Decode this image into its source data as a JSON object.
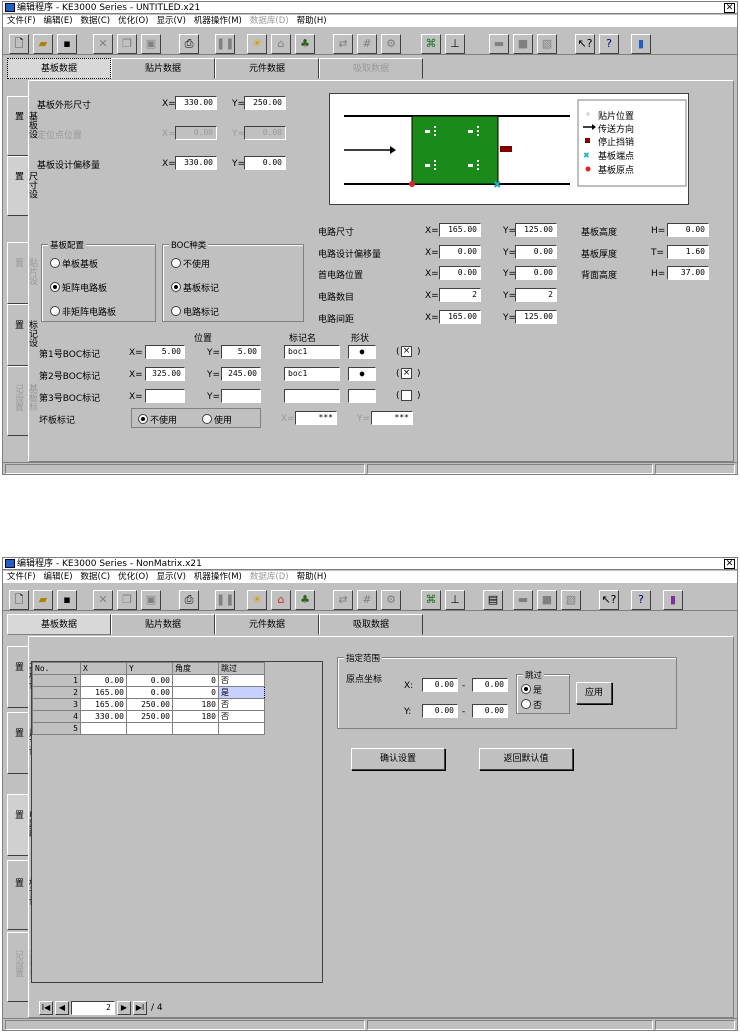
{
  "w1": {
    "title": "编辑程序 - KE3000 Series - UNTITLED.x21",
    "close": "✕",
    "menu": [
      "文件(F)",
      "编辑(E)",
      "数据(C)",
      "优化(O)",
      "显示(V)",
      "机器操作(M)",
      "数据库(D)",
      "帮助(H)"
    ],
    "tabs": [
      "基板数据",
      "贴片数据",
      "元件数据",
      "吸取数据"
    ],
    "side": [
      "基板设置",
      "尺寸设置",
      "贴片设置",
      "标记设置",
      "基板标记设置"
    ],
    "rows": [
      {
        "label": "基板外形尺寸",
        "x": "330.00",
        "y": "250.00"
      },
      {
        "label": "定位点位置",
        "x": "0.00",
        "y": "0.00"
      },
      {
        "label": "基板设计偏移量",
        "x": "330.00",
        "y": "0.00"
      }
    ],
    "xp": "X=",
    "yp": "Y=",
    "legend": [
      "贴片位置",
      "传送方向",
      "停止挡销",
      "基板端点",
      "基板原点"
    ],
    "right_rows": [
      {
        "label": "电路尺寸",
        "x": "165.00",
        "y": "125.00"
      },
      {
        "label": "电路设计偏移量",
        "x": "0.00",
        "y": "0.00"
      },
      {
        "label": "首电路位置",
        "x": "0.00",
        "y": "0.00"
      },
      {
        "label": "电路数目",
        "x": "2",
        "y": "2"
      },
      {
        "label": "电路间距",
        "x": "165.00",
        "y": "125.00"
      }
    ],
    "far": [
      {
        "label": "基板高度",
        "p": "H=",
        "v": "0.00"
      },
      {
        "label": "基板厚度",
        "p": "T=",
        "v": "1.60"
      },
      {
        "label": "背面高度",
        "p": "H=",
        "v": "37.00"
      }
    ],
    "g1_title": "基板配置",
    "g1_opts": [
      "单板基板",
      "矩阵电路板",
      "非矩阵电路板"
    ],
    "g2_title": "BOC种类",
    "g2_opts": [
      "不使用",
      "基板标记",
      "电路标记"
    ],
    "h_pos": "位置",
    "h_mark": "标记名",
    "h_shape": "形状",
    "boc": [
      {
        "label": "第1号BOC标记",
        "x": "5.00",
        "y": "5.00",
        "name": "boc1",
        "chk": "×"
      },
      {
        "label": "第2号BOC标记",
        "x": "325.00",
        "y": "245.00",
        "name": "boc1",
        "chk": "×"
      },
      {
        "label": "第3号BOC标记",
        "x": "",
        "y": "",
        "name": "",
        "chk": ""
      }
    ],
    "bad_label": "坏板标记",
    "bad_opts": [
      "不使用",
      "使用"
    ],
    "bad_x": "***",
    "bad_y": "***",
    "paren_l": "(",
    "paren_r": ")",
    "bullet": "●"
  },
  "w2": {
    "title": "编辑程序 - KE3000 Series - NonMatrix.x21",
    "close": "✕",
    "menu": [
      "文件(F)",
      "编辑(E)",
      "数据(C)",
      "优化(O)",
      "显示(V)",
      "机器操作(M)",
      "数据库(D)",
      "帮助(H)"
    ],
    "tabs": [
      "基板数据",
      "贴片数据",
      "元件数据",
      "吸取数据"
    ],
    "side": [
      "基板设置",
      "尺寸设置",
      "电路配置",
      "标记设置",
      "基板标记设置"
    ],
    "cols": [
      "No.",
      "X",
      "Y",
      "角度",
      "跳过"
    ],
    "table": [
      [
        "1",
        "0.00",
        "0.00",
        "0",
        "否"
      ],
      [
        "2",
        "165.00",
        "0.00",
        "0",
        "是"
      ],
      [
        "3",
        "165.00",
        "250.00",
        "180",
        "否"
      ],
      [
        "4",
        "330.00",
        "250.00",
        "180",
        "否"
      ],
      [
        "5",
        "",
        "",
        "",
        ""
      ]
    ],
    "range_title": "指定范围",
    "origin": "原点坐标",
    "xp": "X:",
    "yp": "Y:",
    "x1": "0.00",
    "x2": "0.00",
    "y1": "0.00",
    "y2": "0.00",
    "dash": "-",
    "skip_title": "跳过",
    "skip_opts": [
      "是",
      "否"
    ],
    "apply": "应用",
    "confirm": "确认设置",
    "reset": "返回默认值",
    "page": "2",
    "of": "/ 4",
    "nav": [
      "I◀",
      "◀",
      "▶",
      "▶I"
    ]
  },
  "toolbar_icons": [
    "new-icon",
    "open-icon",
    "save-icon",
    "cut-icon",
    "copy-icon",
    "paste-icon",
    "print-icon",
    "pause-icon",
    "bulb-icon",
    "machine-icon",
    "optimize-icon",
    "transfer-icon",
    "grid-icon",
    "tool-icon",
    "camera-icon",
    "nozzle-icon",
    "feeder-icon",
    "stop-icon",
    "stack-icon",
    "help-cursor-icon",
    "help-icon",
    "exit-icon"
  ],
  "colors": {
    "board": "#1a8a1a",
    "accent": "#2060c0"
  }
}
